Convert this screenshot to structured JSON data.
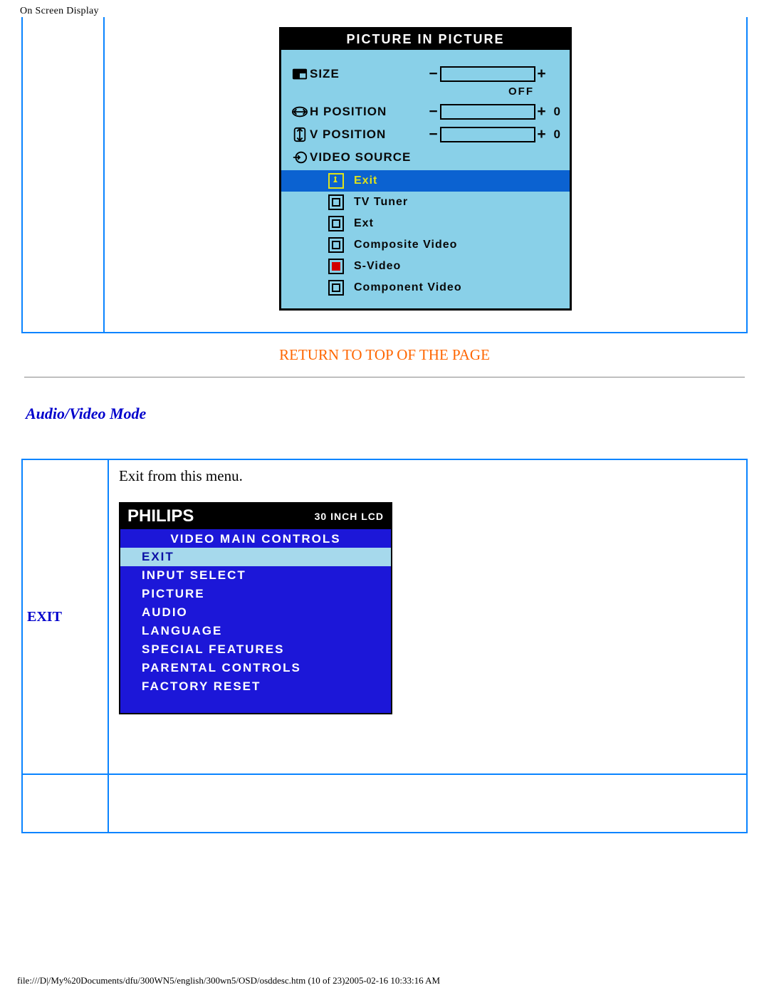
{
  "header": "On Screen Display",
  "pip": {
    "title": "PICTURE IN PICTURE",
    "lines": {
      "size": {
        "label": "Size",
        "value_label": "OFF"
      },
      "hpos": {
        "label": "H Position",
        "trailing": "0"
      },
      "vpos": {
        "label": "V Position",
        "trailing": "0"
      },
      "vsource": {
        "label": "Video Source"
      }
    },
    "source_options": [
      {
        "label": "Exit",
        "selected": true
      },
      {
        "label": "TV Tuner",
        "selected": false
      },
      {
        "label": "Ext",
        "selected": false
      },
      {
        "label": "Composite Video",
        "selected": false
      },
      {
        "label": "S-Video",
        "selected": false,
        "active_source": true
      },
      {
        "label": "Component Video",
        "selected": false
      }
    ]
  },
  "return_link": "RETURN TO TOP OF THE PAGE",
  "section_title": "Audio/Video Mode",
  "av_row": {
    "label": "EXIT",
    "description": "Exit from this menu."
  },
  "philips": {
    "brand": "PHILIPS",
    "model": "30 INCH LCD",
    "title": "VIDEO MAIN CONTROLS",
    "items": [
      {
        "label": "Exit",
        "selected": true
      },
      {
        "label": "Input Select",
        "selected": false
      },
      {
        "label": "Picture",
        "selected": false
      },
      {
        "label": "Audio",
        "selected": false
      },
      {
        "label": "Language",
        "selected": false
      },
      {
        "label": "Special Features",
        "selected": false
      },
      {
        "label": "Parental Controls",
        "selected": false
      },
      {
        "label": "Factory Reset",
        "selected": false
      }
    ]
  },
  "footer": "file:///D|/My%20Documents/dfu/300WN5/english/300wn5/OSD/osddesc.htm (10 of 23)2005-02-16 10:33:16 AM"
}
